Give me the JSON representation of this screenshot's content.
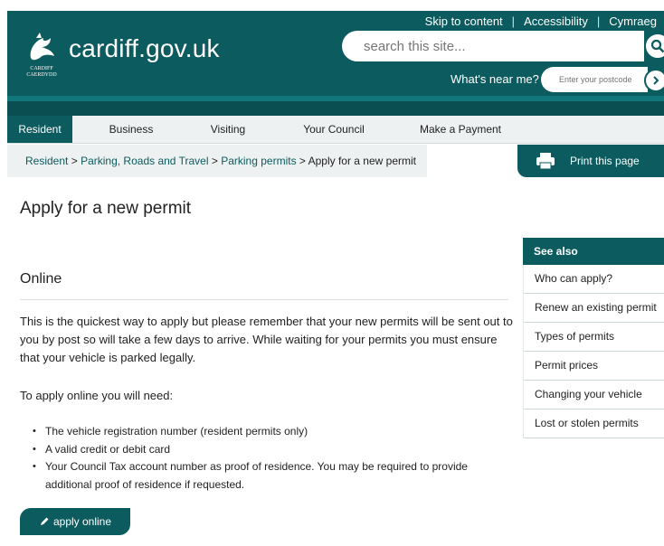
{
  "header": {
    "site_name": "cardiff.gov.uk",
    "logo_text": "CARDIFF CAERDYDD",
    "top_links": [
      "Skip to content",
      "Accessibility",
      "Cymraeg"
    ],
    "search_placeholder": "search this site...",
    "near_me_label": "What's near me?",
    "postcode_placeholder": "Enter your postcode"
  },
  "nav": {
    "items": [
      "Resident",
      "Business",
      "Visiting",
      "Your Council",
      "Make a Payment"
    ],
    "active": "Resident"
  },
  "breadcrumb": {
    "links": [
      "Resident",
      "Parking, Roads and Travel",
      "Parking permits"
    ],
    "current": "Apply for a new permit",
    "separator": ">"
  },
  "print_label": "Print this page",
  "main": {
    "title": "Apply for a new permit",
    "section_title": "Online",
    "intro": "This is the quickest way to apply but please remember that your new permits will be sent out to you by post so will take a few days to arrive.  While waiting for your permits you must ensure that your vehicle is parked legally.",
    "needs_label": "To apply online you will need:",
    "requirements": [
      "The vehicle registration number (resident permits only)",
      "A valid credit or debit card",
      "Your Council Tax account number as proof of residence. You may be required to provide additional proof of residence if requested."
    ],
    "apply_label": "apply online"
  },
  "see_also": {
    "heading": "See also",
    "links": [
      "Who can apply?",
      "Renew an existing permit",
      "Types of permits",
      "Permit prices",
      "Changing your vehicle",
      "Lost or stolen permits"
    ]
  },
  "colors": {
    "brand": "#0c5b5e",
    "nav_bg": "#eef1f1"
  },
  "icons": [
    "dragon-logo-icon",
    "search-icon",
    "arrow-right-icon",
    "printer-icon",
    "pencil-icon"
  ]
}
